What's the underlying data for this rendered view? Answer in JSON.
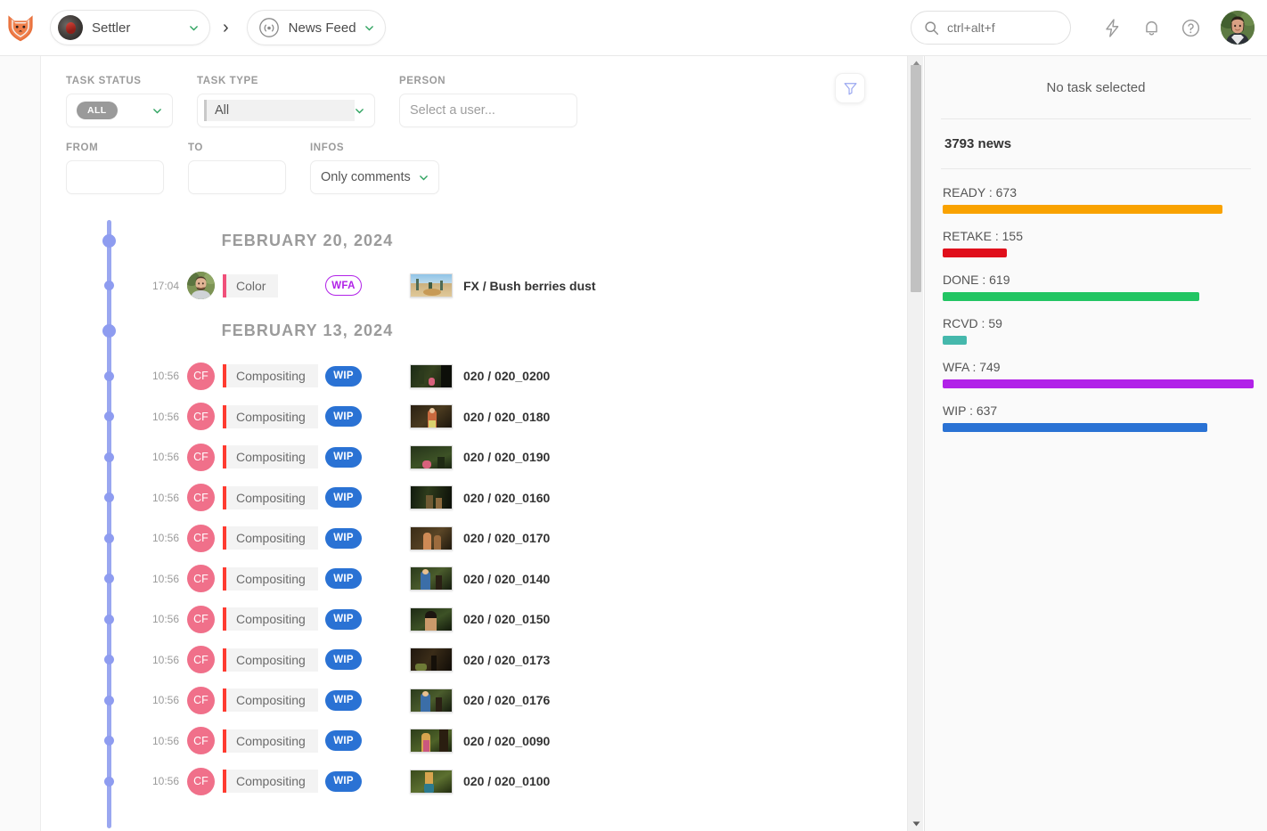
{
  "topbar": {
    "logo_icon": "fox-logo",
    "project": {
      "label": "Settler",
      "chevron_icon": "chevron-down-icon",
      "thumb_icon": "project-thumbnail"
    },
    "breadcrumb_separator": "›",
    "section": {
      "label": "News Feed",
      "icon": "antenna-icon",
      "chevron_icon": "chevron-down-icon"
    },
    "search": {
      "icon": "search-icon",
      "value": "ctrl+alt+f",
      "placeholder": "ctrl+alt+f"
    },
    "actions": [
      {
        "name": "bolt-icon",
        "glyph": "bolt"
      },
      {
        "name": "bell-icon",
        "glyph": "bell"
      },
      {
        "name": "help-icon",
        "glyph": "question"
      }
    ],
    "avatar": {
      "name": "user-avatar"
    }
  },
  "filters": {
    "task_status": {
      "label": "TASK STATUS",
      "value": "ALL",
      "chevron_icon": "chevron-down-icon"
    },
    "task_type": {
      "label": "TASK TYPE",
      "value": "All",
      "chevron_icon": "chevron-down-icon"
    },
    "person": {
      "label": "PERSON",
      "value": "",
      "placeholder": "Select a user..."
    },
    "from": {
      "label": "FROM",
      "value": "",
      "placeholder": ""
    },
    "to": {
      "label": "TO",
      "value": "",
      "placeholder": ""
    },
    "infos": {
      "label": "INFOS",
      "value": "Only comments",
      "chevron_icon": "chevron-down-icon"
    },
    "filter_toggle": {
      "icon": "funnel-icon",
      "color": "#9aa7f0"
    }
  },
  "timeline": {
    "line_color": "#9aa7f0",
    "groups": [
      {
        "date": "FEBRUARY 20, 2024",
        "rows": [
          {
            "time": "17:04",
            "avatar_type": "photo",
            "avatar_initials": "",
            "avatar_color": "#6f8a4e",
            "task_type": "Color",
            "task_type_color": "#f0507a",
            "status": "WFA",
            "status_style": "outline",
            "status_color": "#b122e8",
            "entity": "FX / Bush berries dust",
            "thumb_style": "desert"
          }
        ]
      },
      {
        "date": "FEBRUARY 13, 2024",
        "rows": [
          {
            "time": "10:56",
            "avatar_type": "initials",
            "avatar_initials": "CF",
            "avatar_color": "#f0708a",
            "task_type": "Compositing",
            "task_type_color": "#ff3b30",
            "status": "WIP",
            "status_style": "solid",
            "status_color": "#2a72d4",
            "entity": "020 / 020_0200",
            "thumb_style": "forest-dark"
          },
          {
            "time": "10:56",
            "avatar_type": "initials",
            "avatar_initials": "CF",
            "avatar_color": "#f0708a",
            "task_type": "Compositing",
            "task_type_color": "#ff3b30",
            "status": "WIP",
            "status_style": "solid",
            "status_color": "#2a72d4",
            "entity": "020 / 020_0180",
            "thumb_style": "forest-girl"
          },
          {
            "time": "10:56",
            "avatar_type": "initials",
            "avatar_initials": "CF",
            "avatar_color": "#f0708a",
            "task_type": "Compositing",
            "task_type_color": "#ff3b30",
            "status": "WIP",
            "status_style": "solid",
            "status_color": "#2a72d4",
            "entity": "020 / 020_0190",
            "thumb_style": "forest-ground"
          },
          {
            "time": "10:56",
            "avatar_type": "initials",
            "avatar_initials": "CF",
            "avatar_color": "#f0708a",
            "task_type": "Compositing",
            "task_type_color": "#ff3b30",
            "status": "WIP",
            "status_style": "solid",
            "status_color": "#2a72d4",
            "entity": "020 / 020_0160",
            "thumb_style": "forest-night"
          },
          {
            "time": "10:56",
            "avatar_type": "initials",
            "avatar_initials": "CF",
            "avatar_color": "#f0708a",
            "task_type": "Compositing",
            "task_type_color": "#ff3b30",
            "status": "WIP",
            "status_style": "solid",
            "status_color": "#2a72d4",
            "entity": "020 / 020_0170",
            "thumb_style": "forest-two"
          },
          {
            "time": "10:56",
            "avatar_type": "initials",
            "avatar_initials": "CF",
            "avatar_color": "#f0708a",
            "task_type": "Compositing",
            "task_type_color": "#ff3b30",
            "status": "WIP",
            "status_style": "solid",
            "status_color": "#2a72d4",
            "entity": "020 / 020_0140",
            "thumb_style": "forest-blue"
          },
          {
            "time": "10:56",
            "avatar_type": "initials",
            "avatar_initials": "CF",
            "avatar_color": "#f0708a",
            "task_type": "Compositing",
            "task_type_color": "#ff3b30",
            "status": "WIP",
            "status_style": "solid",
            "status_color": "#2a72d4",
            "entity": "020 / 020_0150",
            "thumb_style": "forest-face"
          },
          {
            "time": "10:56",
            "avatar_type": "initials",
            "avatar_initials": "CF",
            "avatar_color": "#f0708a",
            "task_type": "Compositing",
            "task_type_color": "#ff3b30",
            "status": "WIP",
            "status_style": "solid",
            "status_color": "#2a72d4",
            "entity": "020 / 020_0173",
            "thumb_style": "forest-path"
          },
          {
            "time": "10:56",
            "avatar_type": "initials",
            "avatar_initials": "CF",
            "avatar_color": "#f0708a",
            "task_type": "Compositing",
            "task_type_color": "#ff3b30",
            "status": "WIP",
            "status_style": "solid",
            "status_color": "#2a72d4",
            "entity": "020 / 020_0176",
            "thumb_style": "forest-blue"
          },
          {
            "time": "10:56",
            "avatar_type": "initials",
            "avatar_initials": "CF",
            "avatar_color": "#f0708a",
            "task_type": "Compositing",
            "task_type_color": "#ff3b30",
            "status": "WIP",
            "status_style": "solid",
            "status_color": "#2a72d4",
            "entity": "020 / 020_0090",
            "thumb_style": "forest-blond"
          },
          {
            "time": "10:56",
            "avatar_type": "initials",
            "avatar_initials": "CF",
            "avatar_color": "#f0708a",
            "task_type": "Compositing",
            "task_type_color": "#ff3b30",
            "status": "WIP",
            "status_style": "solid",
            "status_color": "#2a72d4",
            "entity": "020 / 020_0100",
            "thumb_style": "forest-boots"
          }
        ]
      }
    ]
  },
  "right_panel": {
    "title": "No task selected",
    "count_label": "3793 news"
  },
  "chart_data": {
    "type": "bar",
    "title": "3793 news",
    "orientation": "horizontal",
    "categories": [
      "READY",
      "RETAKE",
      "DONE",
      "RCVD",
      "WFA",
      "WIP"
    ],
    "values": [
      673,
      155,
      619,
      59,
      749,
      637
    ],
    "labels": [
      "READY : 673",
      "RETAKE : 155",
      "DONE : 619",
      "RCVD : 59",
      "WFA : 749",
      "WIP : 637"
    ],
    "colors": [
      "#f9a200",
      "#e00f1b",
      "#22c563",
      "#45b8ac",
      "#b122e8",
      "#2a72d4"
    ],
    "max": 749,
    "xlabel": "",
    "ylabel": "",
    "grid": false,
    "legend": "none"
  },
  "scrollbar": {
    "up_arrow_icon": "caret-up-icon",
    "down_arrow_icon": "caret-down-icon"
  }
}
